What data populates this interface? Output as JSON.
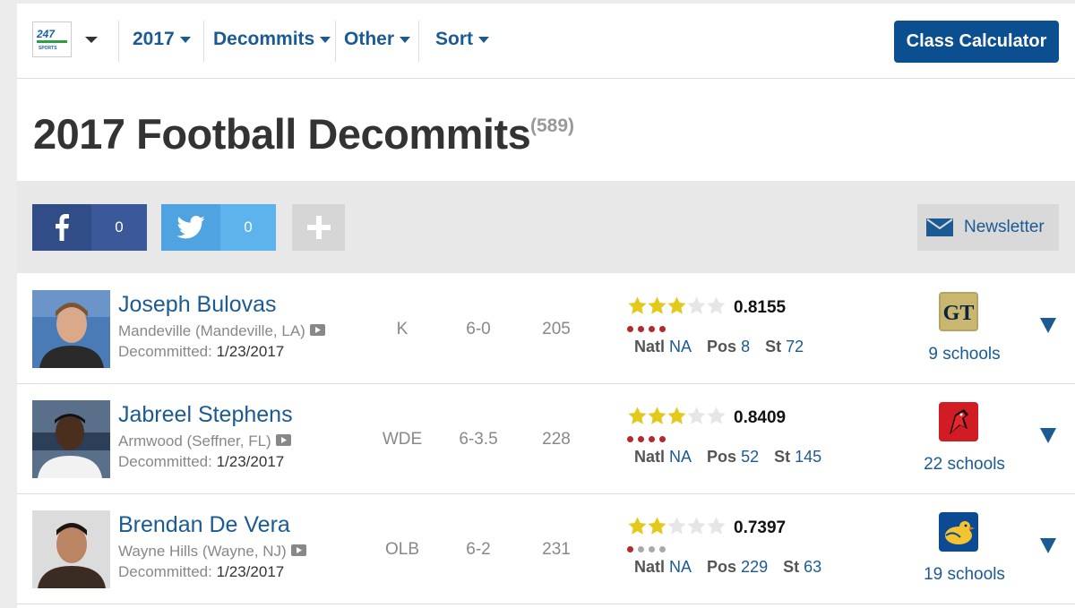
{
  "nav": {
    "logo_text": "247 SPORTS",
    "items": [
      "2017",
      "Decommits",
      "Other",
      "Sort"
    ],
    "class_calculator": "Class Calculator"
  },
  "heading": {
    "title": "2017 Football Decommits",
    "count": "(589)"
  },
  "social": {
    "facebook_count": "0",
    "twitter_count": "0",
    "newsletter": "Newsletter"
  },
  "labels": {
    "decommitted": "Decommitted:",
    "natl": "Natl",
    "pos": "Pos",
    "st": "St"
  },
  "colors": {
    "brand_blue": "#0b4f90",
    "link_blue": "#1b5a93",
    "star_gold": "#e2c91a",
    "dot_red": "#b5282b"
  },
  "players": [
    {
      "name": "Joseph Bulovas",
      "school": "Mandeville (Mandeville, LA)",
      "date": "1/23/2017",
      "position": "K",
      "height": "6-0",
      "weight": "205",
      "stars": 3,
      "rating": "0.8155",
      "dots_filled": 4,
      "natl": "NA",
      "pos_rank": "8",
      "st_rank": "72",
      "team_icon": "georgia-tech-logo",
      "schools": "9 schools"
    },
    {
      "name": "Jabreel Stephens",
      "school": "Armwood (Seffner, FL)",
      "date": "1/23/2017",
      "position": "WDE",
      "height": "6-3.5",
      "weight": "228",
      "stars": 3,
      "rating": "0.8409",
      "dots_filled": 4,
      "natl": "NA",
      "pos_rank": "52",
      "st_rank": "145",
      "team_icon": "louisville-cardinal-logo",
      "schools": "22 schools"
    },
    {
      "name": "Brendan De Vera",
      "school": "Wayne Hills (Wayne, NJ)",
      "date": "1/23/2017",
      "position": "OLB",
      "height": "6-2",
      "weight": "231",
      "stars": 2,
      "rating": "0.7397",
      "dots_filled": 1,
      "natl": "NA",
      "pos_rank": "229",
      "st_rank": "63",
      "team_icon": "delaware-blue-hen-logo",
      "schools": "19 schools"
    }
  ]
}
